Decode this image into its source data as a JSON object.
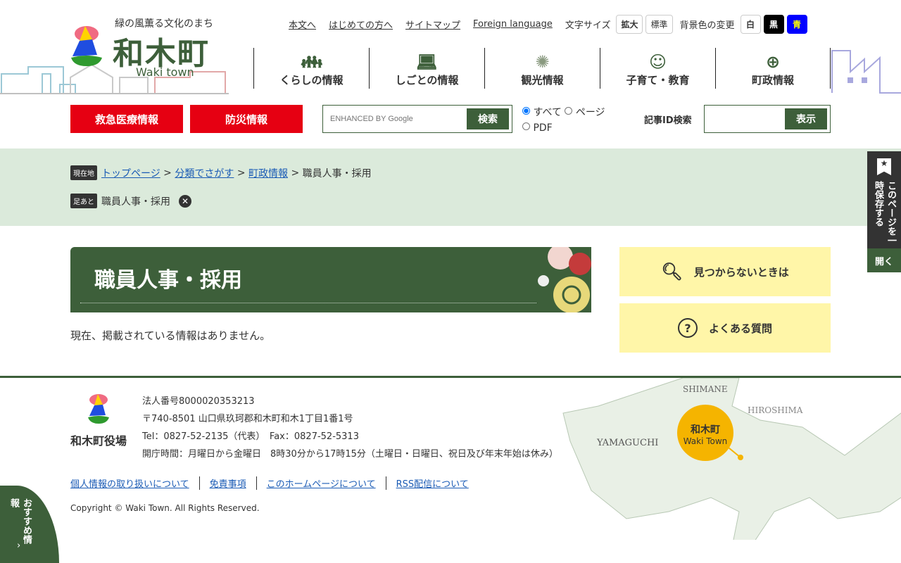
{
  "header": {
    "tagline": "緑の風薫る文化のまち",
    "logo": "和木町",
    "logo_en": "Waki town"
  },
  "util": {
    "links": [
      "本文へ",
      "はじめての方へ",
      "サイトマップ",
      "Foreign language"
    ],
    "font_size_label": "文字サイズ",
    "font_large": "拡大",
    "font_std": "標準",
    "bg_label": "背景色の変更",
    "bg_white": "白",
    "bg_black": "黒",
    "bg_blue": "青"
  },
  "nav": [
    {
      "label": "くらしの情報",
      "icon": "family-icon"
    },
    {
      "label": "しごとの情報",
      "icon": "worker-icon"
    },
    {
      "label": "観光情報",
      "icon": "fireworks-icon"
    },
    {
      "label": "子育て・教育",
      "icon": "child-face-icon"
    },
    {
      "label": "町政情報",
      "icon": "town-emblem-icon"
    }
  ],
  "buttons": {
    "emergency": "救急医療情報",
    "disaster": "防災情報"
  },
  "search": {
    "placeholder": "ENHANCED BY Google",
    "button": "検索",
    "options": [
      "すべて",
      "ページ",
      "PDF"
    ],
    "selected": "すべて"
  },
  "article_search": {
    "label": "記事ID検索",
    "button": "表示",
    "value": ""
  },
  "breadcrumb": {
    "tag": "現在地",
    "items": [
      "トップページ",
      "分類でさがす",
      "町政情報"
    ],
    "current": "職員人事・採用"
  },
  "footprint": {
    "tag": "足あと",
    "item": "職員人事・採用"
  },
  "main": {
    "title": "職員人事・採用",
    "message": "現在、掲載されている情報はありません。"
  },
  "sidebar": [
    {
      "label": "見つからないときは",
      "icon": "search-document-icon"
    },
    {
      "label": "よくある質問",
      "icon": "question-icon"
    }
  ],
  "save_tab": {
    "label": "このページを一時保存する",
    "open": "開く"
  },
  "recommend_tab": {
    "label": "おすすめ情報"
  },
  "footer": {
    "org": "和木町役場",
    "corp_no": "法人番号8000020353213",
    "address": "〒740-8501 山口県玖珂郡和木町和木1丁目1番1号",
    "tel": "Tel：0827-52-2135（代表）　Fax：0827-52-5313",
    "hours": "開庁時間：月曜日から金曜日　8時30分から17時15分（土曜日・日曜日、祝日及び年末年始は休み）",
    "links": [
      "個人情報の取り扱いについて",
      "免責事項",
      "このホームページについて",
      "RSS配信について"
    ],
    "copyright": "Copyright © Waki Town. All Rights Reserved."
  },
  "map": {
    "labels": [
      "SHIMANE",
      "HIROSHIMA",
      "YAMAGUCHI"
    ],
    "pin_title": "和木町",
    "pin_sub": "Waki Town"
  },
  "colors": {
    "green": "#3d5f3a",
    "red": "#e60012",
    "yellow": "#fff6a8",
    "crumb_bg": "#dbeadb"
  }
}
